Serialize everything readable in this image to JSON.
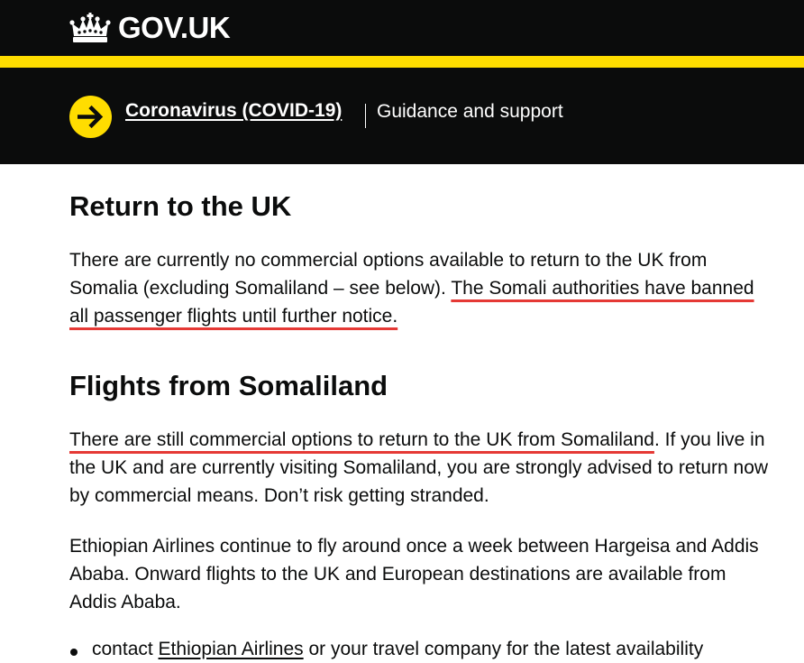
{
  "header": {
    "logo_text": "GOV.UK",
    "logo_icon": "crown-icon",
    "accent_color": "#ffdd00"
  },
  "banner": {
    "arrow_icon": "arrow-right-icon",
    "link": "Coronavirus (COVID-19)",
    "subtitle": "Guidance and support"
  },
  "content": {
    "heading_return": "Return to the UK",
    "return_text": "There are currently no commercial options available to return to the UK from Somalia (excluding Somaliland – see below). ",
    "return_highlight": "The Somali authorities have banned all passenger flights until further notice.",
    "heading_flights": "Flights from Somaliland",
    "flights_highlight": "There are still commercial options to return to the UK from Somaliland",
    "flights_text": ". If you live in the UK and are currently visiting Somaliland, you are strongly advised to return now by commercial means. Don’t risk getting stranded.",
    "ethiopian_text": "Ethiopian Airlines continue to fly around once a week between Hargeisa and Addis Ababa. Onward flights to the UK and European destinations are available from Addis Ababa.",
    "bullet_prefix": "contact ",
    "bullet_link": "Ethiopian Airlines",
    "bullet_suffix": " or your travel company for the latest availability"
  }
}
